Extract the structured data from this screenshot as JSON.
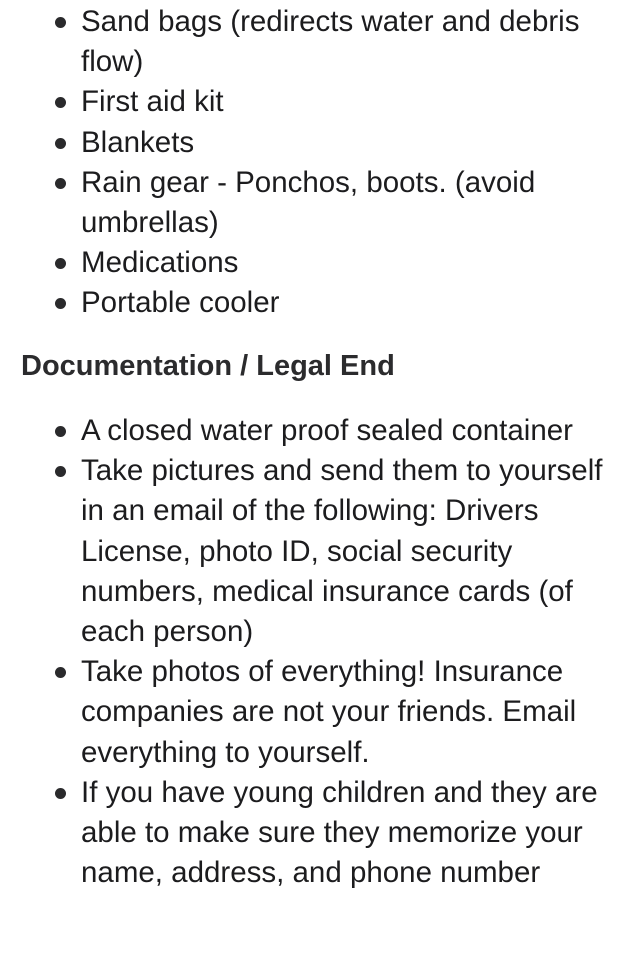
{
  "supplies": {
    "items": [
      {
        "text": "Sand bags (redirects water and debris flow)"
      },
      {
        "text": "First aid kit"
      },
      {
        "text": "Blankets"
      },
      {
        "text": "Rain gear - Ponchos, boots. (avoid umbrellas)"
      },
      {
        "text": "Medications"
      },
      {
        "text": "Portable cooler"
      }
    ]
  },
  "documentation": {
    "heading": "Documentation / Legal End",
    "items": [
      {
        "text": "A closed water proof sealed container"
      },
      {
        "text": "Take pictures and send them to yourself in an email of the following: Drivers License, photo ID, social security numbers, medical insurance cards (of each person)"
      },
      {
        "text": "Take photos of everything! Insurance companies are not your friends. Email everything to yourself."
      },
      {
        "text": "If you have young children and they are able to make sure they memorize your name, address, and phone number"
      }
    ]
  }
}
